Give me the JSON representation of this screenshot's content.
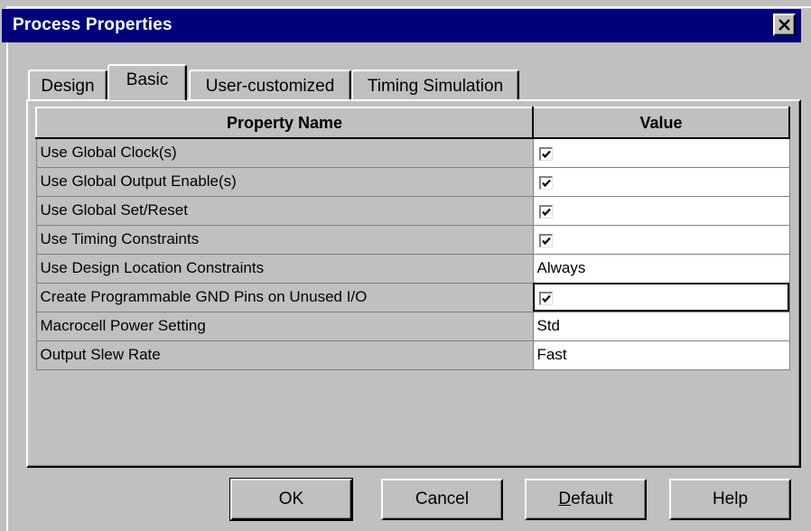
{
  "window": {
    "title": "Process Properties"
  },
  "tabs": [
    {
      "label": "Design",
      "active": false
    },
    {
      "label": "Basic",
      "active": true
    },
    {
      "label": "User-customized",
      "active": false
    },
    {
      "label": "Timing Simulation",
      "active": false
    }
  ],
  "grid": {
    "headers": {
      "name": "Property Name",
      "value": "Value"
    },
    "rows": [
      {
        "name": "Use Global Clock(s)",
        "type": "checkbox",
        "checked": true
      },
      {
        "name": "Use Global Output Enable(s)",
        "type": "checkbox",
        "checked": true
      },
      {
        "name": "Use Global Set/Reset",
        "type": "checkbox",
        "checked": true
      },
      {
        "name": "Use Timing Constraints",
        "type": "checkbox",
        "checked": true
      },
      {
        "name": "Use Design Location Constraints",
        "type": "text",
        "value": "Always"
      },
      {
        "name": "Create Programmable GND Pins on Unused I/O",
        "type": "checkbox",
        "checked": true
      },
      {
        "name": "Macrocell Power Setting",
        "type": "text",
        "value": "Std"
      },
      {
        "name": "Output Slew Rate",
        "type": "text",
        "value": "Fast"
      }
    ]
  },
  "buttons": {
    "ok": "OK",
    "cancel": "Cancel",
    "default_prefix": "D",
    "default_rest": "efault",
    "help": "Help"
  },
  "icons": {
    "close": "close-icon",
    "check": "checkmark-icon"
  }
}
